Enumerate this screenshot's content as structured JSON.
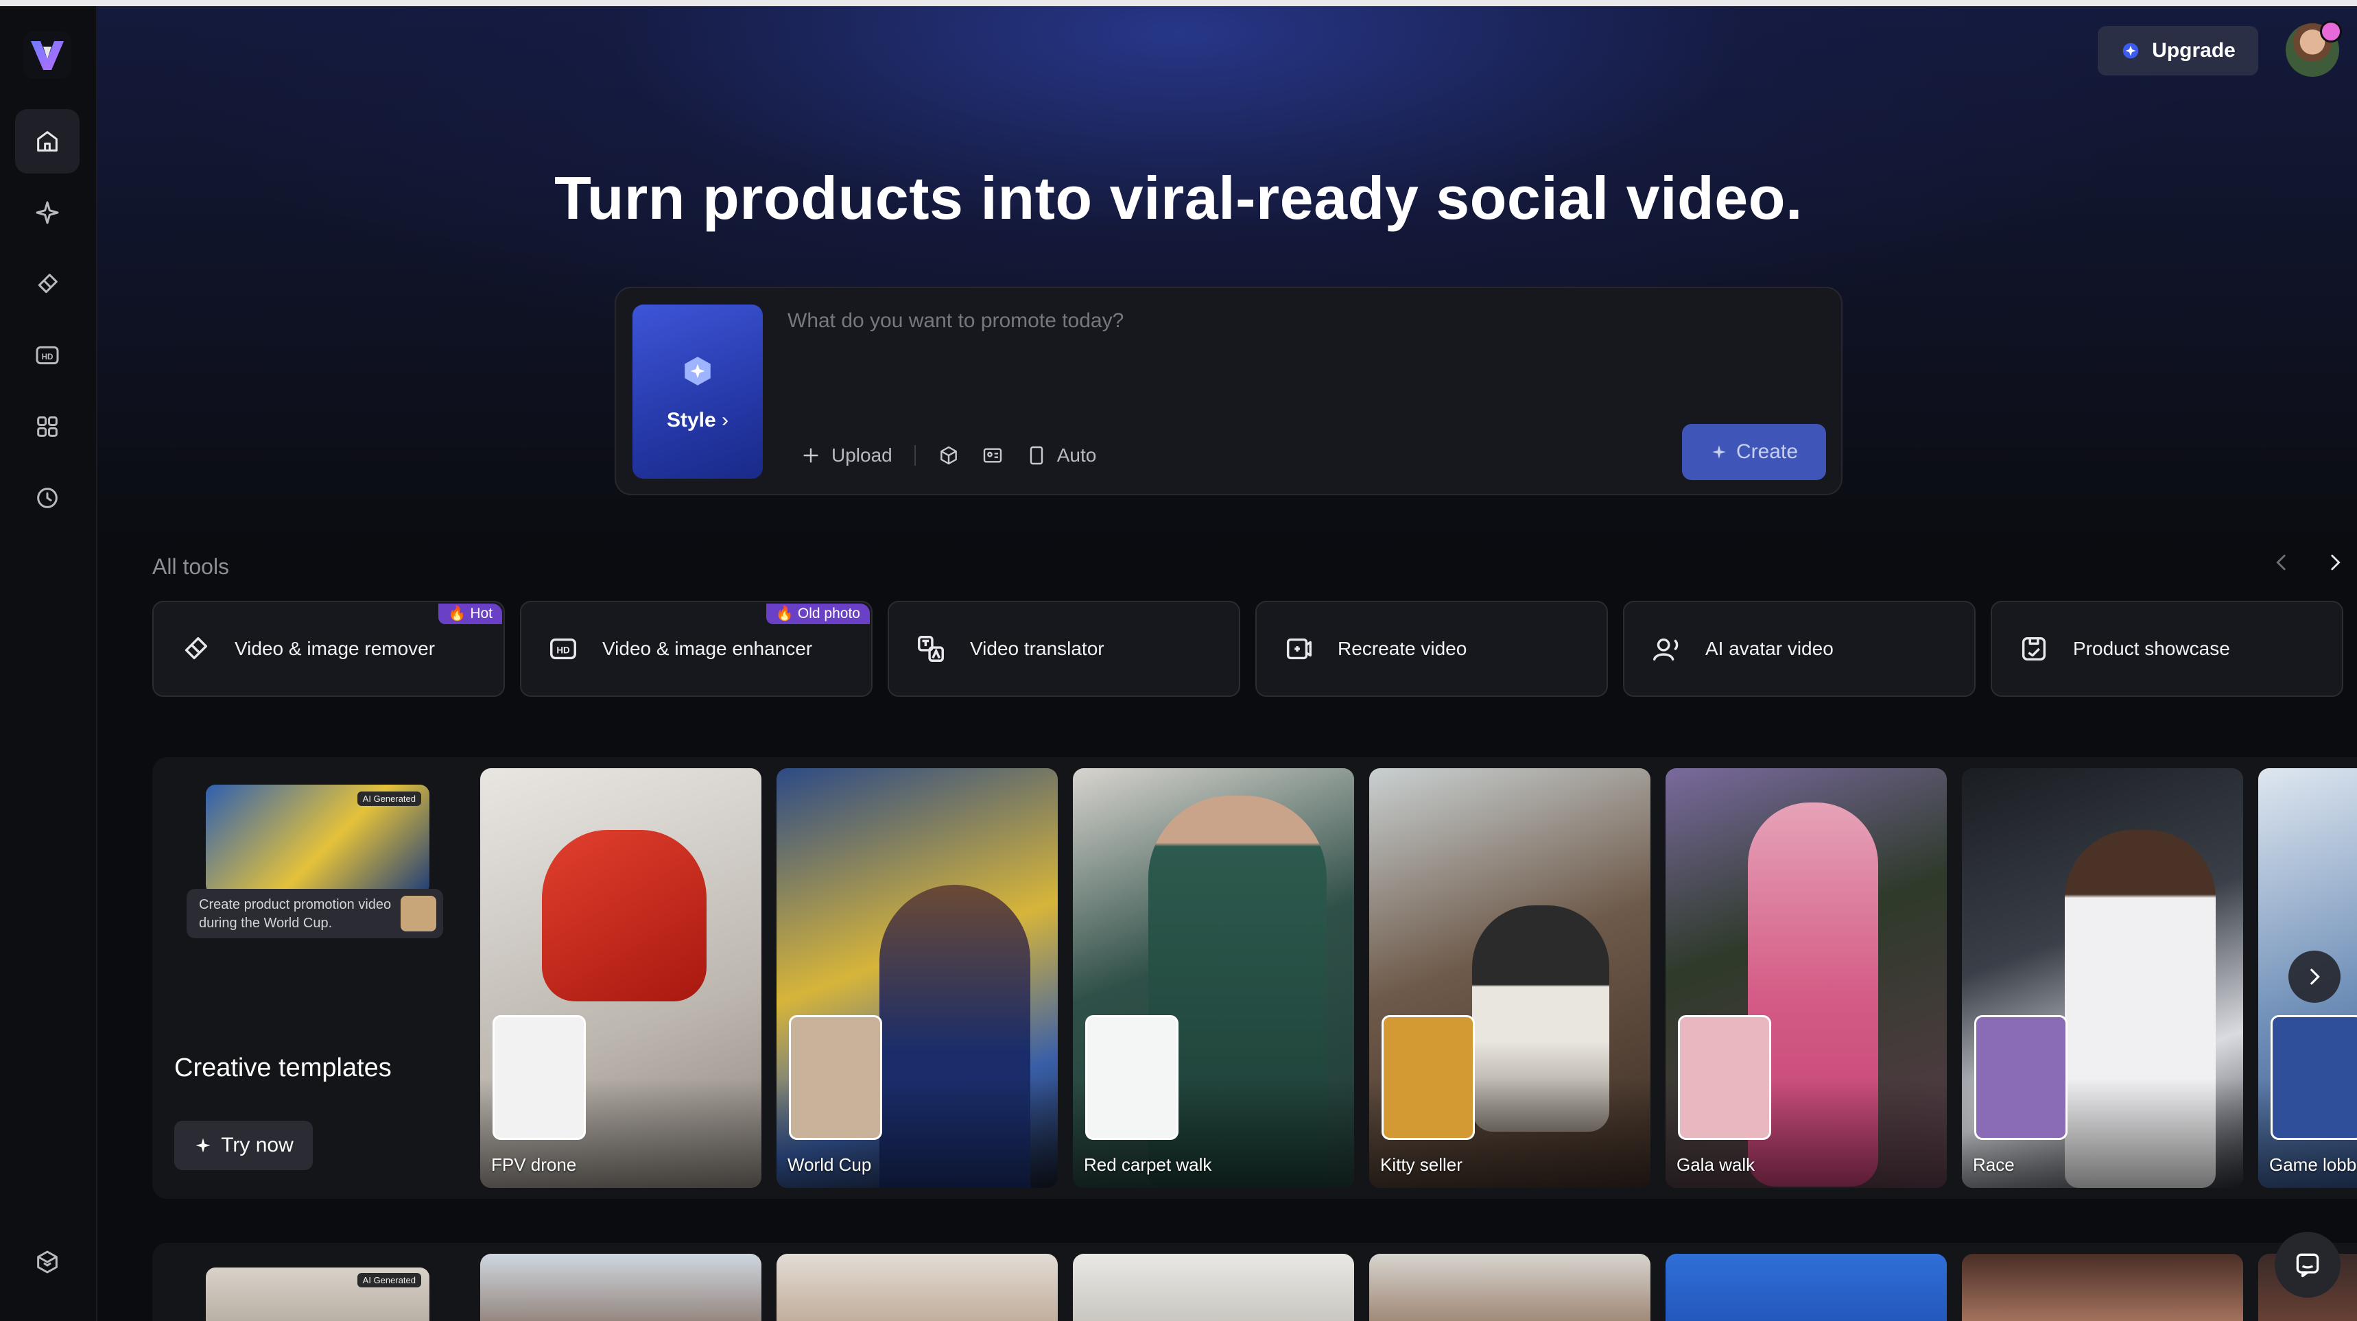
{
  "colors": {
    "accent": "#3f56b8",
    "badge": "#6a40c7",
    "background": "#0b0c10"
  },
  "sidebar": {
    "items": [
      {
        "icon": "home-icon",
        "active": true
      },
      {
        "icon": "sparkle-magic-icon"
      },
      {
        "icon": "eraser-icon"
      },
      {
        "icon": "hd-icon"
      },
      {
        "icon": "apps-grid-icon"
      },
      {
        "icon": "history-clock-icon"
      }
    ],
    "bottom_icon": "box-package-icon"
  },
  "header": {
    "upgrade_label": "Upgrade"
  },
  "hero": {
    "title": "Turn products into viral-ready social video."
  },
  "prompt": {
    "placeholder": "What do you want to promote today?",
    "style_label": "Style",
    "upload_label": "Upload",
    "auto_label": "Auto",
    "create_label": "Create"
  },
  "tools": {
    "section_label": "All tools",
    "items": [
      {
        "label": "Video & image remover",
        "badge": "Hot",
        "icon": "eraser-icon"
      },
      {
        "label": "Video & image enhancer",
        "badge": "Old photo",
        "icon": "hd-icon"
      },
      {
        "label": "Video translator",
        "icon": "translate-icon"
      },
      {
        "label": "Recreate video",
        "icon": "recreate-icon"
      },
      {
        "label": "AI avatar video",
        "icon": "avatar-icon"
      },
      {
        "label": "Product showcase",
        "icon": "product-icon"
      }
    ]
  },
  "templates": {
    "preview_tag": "AI Generated",
    "preview_caption": "Create product promotion video during the World Cup.",
    "title": "Creative templates",
    "try_label": "Try now",
    "cards": [
      {
        "label": "FPV drone"
      },
      {
        "label": "World Cup"
      },
      {
        "label": "Red carpet walk"
      },
      {
        "label": "Kitty seller"
      },
      {
        "label": "Gala walk"
      },
      {
        "label": "Race"
      },
      {
        "label": "Game lobb"
      }
    ]
  },
  "row2": {
    "preview_tag": "AI Generated"
  }
}
